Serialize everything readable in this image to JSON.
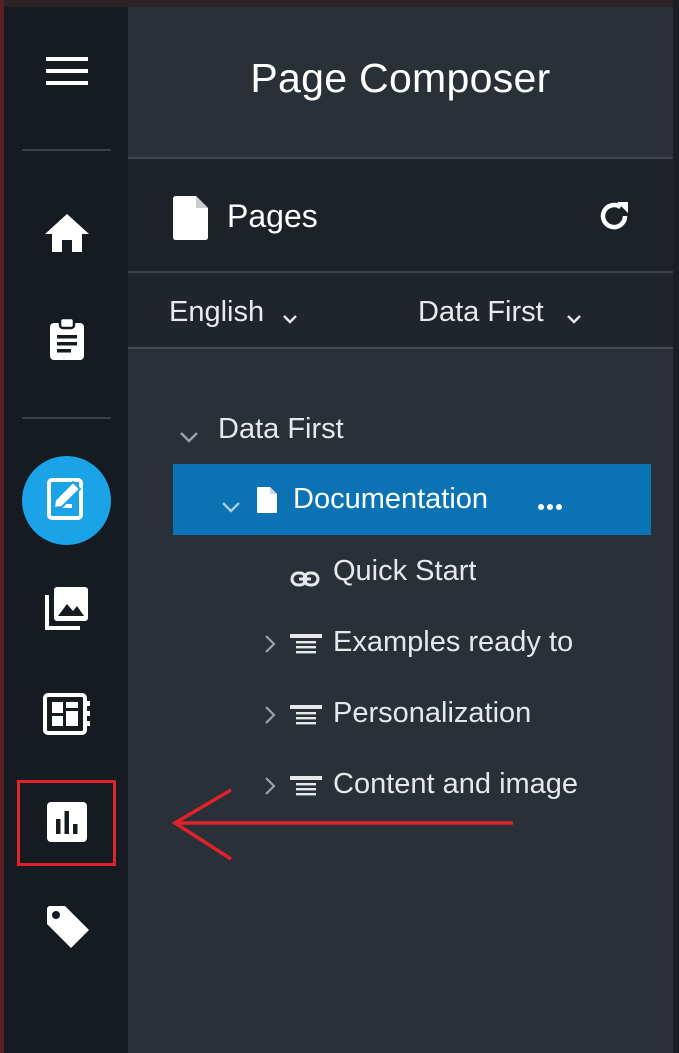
{
  "panel": {
    "title": "Page Composer",
    "pages_label": "Pages",
    "language": "English",
    "site": "Data First"
  },
  "rail": {
    "items": [
      {
        "icon": "menu-icon"
      },
      {
        "icon": "home-icon"
      },
      {
        "icon": "clipboard-icon"
      },
      {
        "icon": "page-edit-icon",
        "active": true
      },
      {
        "icon": "media-library-icon"
      },
      {
        "icon": "dashboard-icon"
      },
      {
        "icon": "analytics-icon",
        "highlighted": true
      },
      {
        "icon": "tag-icon"
      }
    ]
  },
  "tree": {
    "root": "Data First",
    "selected": "Documentation",
    "children": [
      {
        "label": "Quick Start",
        "icon": "link-icon"
      },
      {
        "label": "Examples ready to",
        "icon": "text-lines-icon"
      },
      {
        "label": "Personalization",
        "icon": "text-lines-icon"
      },
      {
        "label": "Content and images",
        "icon": "text-lines-icon"
      }
    ]
  },
  "colors": {
    "rail_bg": "#151b21",
    "panel_bg": "#2a3037",
    "accent": "#1aa3e6",
    "selected_row": "#0b73b3",
    "annotation": "#e0222b"
  }
}
